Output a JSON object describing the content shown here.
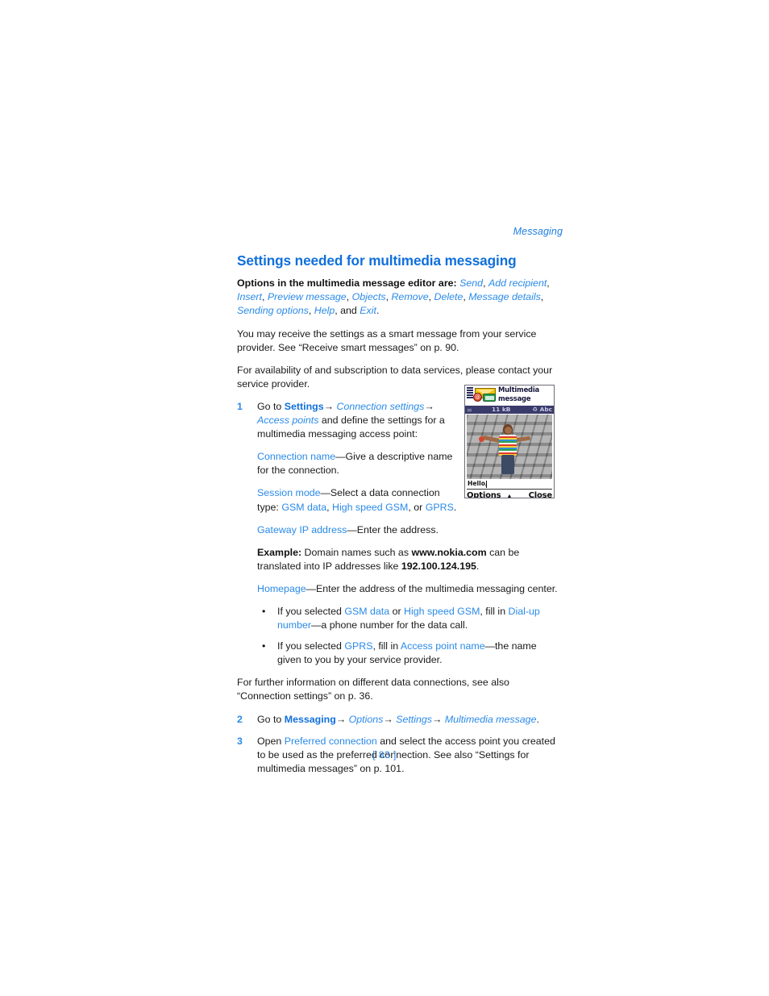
{
  "header": {
    "running_head": "Messaging"
  },
  "title": "Settings needed for multimedia messaging",
  "intro": {
    "lead": "Options in the multimedia message editor are:",
    "options": [
      "Send",
      "Add recipient",
      "Insert",
      "Preview message",
      "Objects",
      "Remove",
      "Delete",
      "Message details",
      "Sending options",
      "Help",
      "Exit"
    ],
    "conjunction": "and",
    "full_text_line1_prefix": "Options in the multimedia message editor are: ",
    "trailing_period": "."
  },
  "paragraphs": {
    "smart_message": "You may receive the settings as a smart message from your service provider. See “Receive smart messages” on p. 90.",
    "availability": "For availability of and subscription to data services, please contact your service provider.",
    "further_info": "For further information on different data connections, see also “Connection settings” on p. 36."
  },
  "steps": [
    {
      "num": "1",
      "line_goto": "Go to",
      "link_settings": "Settings",
      "arrow": "→",
      "link_connection_settings": "Connection settings",
      "link_access_points": "Access points",
      "tail": " and define the settings for a multimedia messaging access point:",
      "blocks": [
        {
          "link": "Connection name",
          "dash": "—",
          "text": "Give a descriptive name for the connection."
        },
        {
          "link": "Session mode",
          "dash": "—",
          "text": "Select a data connection type: ",
          "types": [
            "GSM data",
            "High speed GSM",
            "GPRS"
          ],
          "types_join": ", ",
          "types_last_join": ", or ",
          "end": "."
        },
        {
          "link": "Gateway IP address",
          "dash": "—",
          "text": "Enter the address."
        }
      ]
    },
    {
      "num": "2",
      "line_goto": "Go to",
      "link_messaging": "Messaging",
      "arrow": "→",
      "link_options": "Options",
      "link_settings": "Settings",
      "link_multimedia_message": "Multimedia message",
      "end": "."
    },
    {
      "num": "3",
      "open_word": "Open",
      "link_preferred_connection": "Preferred connection",
      "tail": " and select the access point you created to be used as the preferred connection. See also “Settings for multimedia messages” on p. 101."
    }
  ],
  "example": {
    "label": "Example:",
    "text_1": " Domain names such as ",
    "domain": "www.nokia.com",
    "text_2": " can be translated into IP addresses like ",
    "ip": "192.100.124.195",
    "text_3": "."
  },
  "homepage": {
    "link": "Homepage",
    "dash": "—",
    "text": "Enter the address of the multimedia messaging center."
  },
  "bullets": [
    {
      "bullet": "•",
      "text_1": "If you selected ",
      "link_1": "GSM data",
      "text_2": " or ",
      "link_2": "High speed GSM",
      "text_3": ", fill in ",
      "link_3": "Dial-up number",
      "text_4": "—a phone number for the data call."
    },
    {
      "bullet": "•",
      "text_1": "If you selected ",
      "link_1": "GPRS",
      "text_2": ", fill in ",
      "link_2": "Access point name",
      "text_3": "—the name given to you by your service provider."
    }
  ],
  "figure": {
    "alt": "phone-screenshot-multimedia-message",
    "title_line1": "Multimedia",
    "title_line2": "message",
    "size_label": "11 kB",
    "input_mode": "Abc",
    "antenna_icon": "antenna-icon",
    "mute_icon": "mute-icon",
    "envelope_icon": "envelope-icon",
    "at_icon": "@",
    "note_icon": "audio-note-icon",
    "signal_icon": "signal-bars-icon",
    "message_text": "Hello,",
    "softkey_left": "Options",
    "softkey_mid": "▲",
    "softkey_right": "Close"
  },
  "page_number": "[ 83 ]",
  "colors": {
    "heading_blue": "#0f6fdb",
    "link_blue": "#2a8ae8",
    "running_head_blue": "#1f7fe0",
    "body_text": "#1a1a1a",
    "page_background": "#ffffff"
  }
}
